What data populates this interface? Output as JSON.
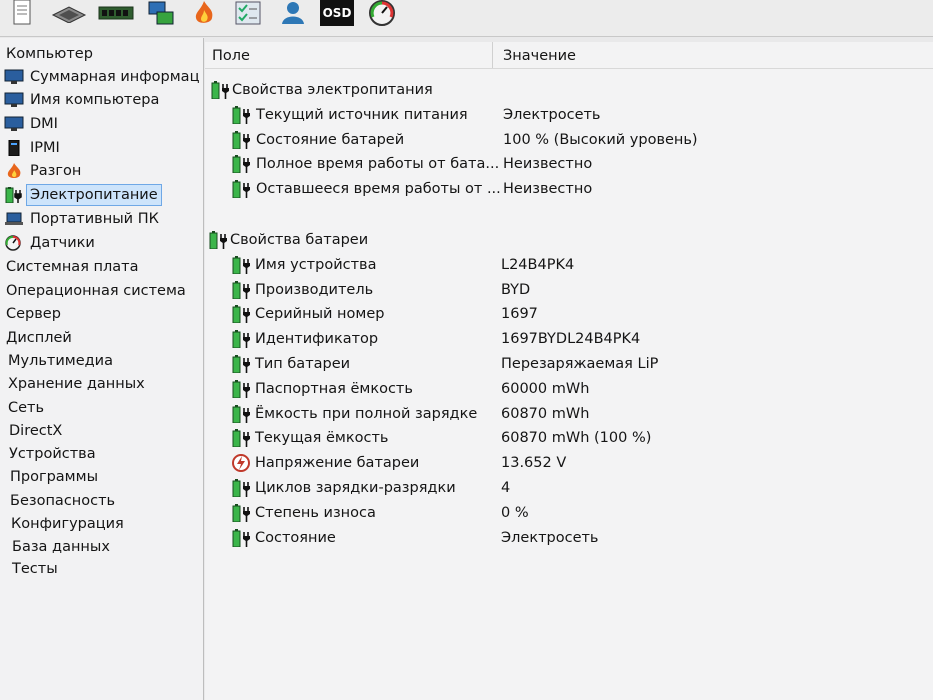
{
  "toolbar": {
    "icons": [
      "document-icon",
      "chip-icon",
      "memory-icon",
      "network-icon",
      "flame-icon",
      "checklist-icon",
      "user-icon",
      "osd-icon",
      "gauge-icon"
    ],
    "osd_label": "OSD"
  },
  "sidebar": {
    "root": "Компьютер",
    "items": [
      {
        "label": "Суммарная информац",
        "icon": "monitor-icon"
      },
      {
        "label": "Имя компьютера",
        "icon": "monitor-icon"
      },
      {
        "label": "DMI",
        "icon": "monitor-icon"
      },
      {
        "label": "IPMI",
        "icon": "server-icon"
      },
      {
        "label": "Разгон",
        "icon": "flame-icon"
      },
      {
        "label": "Электропитание",
        "icon": "battery-icon"
      },
      {
        "label": "Портативный ПК",
        "icon": "laptop-icon"
      },
      {
        "label": "Датчики",
        "icon": "gauge-icon"
      },
      {
        "label": "Системная плата",
        "icon": ""
      },
      {
        "label": "Операционная система",
        "icon": ""
      },
      {
        "label": "Сервер",
        "icon": ""
      },
      {
        "label": "Дисплей",
        "icon": ""
      },
      {
        "label": "Мультимедиа",
        "icon": ""
      },
      {
        "label": "Хранение данных",
        "icon": ""
      },
      {
        "label": "Сеть",
        "icon": ""
      },
      {
        "label": "DirectX",
        "icon": ""
      },
      {
        "label": "Устройства",
        "icon": ""
      },
      {
        "label": "Программы",
        "icon": ""
      },
      {
        "label": "Безопасность",
        "icon": ""
      },
      {
        "label": "Конфигурация",
        "icon": ""
      },
      {
        "label": "База данных",
        "icon": ""
      },
      {
        "label": "Тесты",
        "icon": ""
      }
    ]
  },
  "list": {
    "col_field": "Поле",
    "col_value": "Значение",
    "group1": {
      "title": "Свойства электропитания",
      "rows": [
        {
          "field": "Текущий источник питания",
          "value": "Электросеть"
        },
        {
          "field": "Состояние батарей",
          "value": "100 % (Высокий уровень)"
        },
        {
          "field": "Полное время работы от бата...",
          "value": "Неизвестно"
        },
        {
          "field": "Оставшееся время работы от ...",
          "value": "Неизвестно"
        }
      ]
    },
    "group2": {
      "title": "Свойства батареи",
      "rows": [
        {
          "field": "Имя устройства",
          "value": "L24B4PK4"
        },
        {
          "field": "Производитель",
          "value": "BYD"
        },
        {
          "field": "Серийный номер",
          "value": "1697"
        },
        {
          "field": "Идентификатор",
          "value": "1697BYDL24B4PK4"
        },
        {
          "field": "Тип батареи",
          "value": "Перезаряжаемая LiP"
        },
        {
          "field": "Паспортная ёмкость",
          "value": "60000 mWh"
        },
        {
          "field": "Ёмкость при полной зарядке",
          "value": "60870 mWh"
        },
        {
          "field": "Текущая ёмкость",
          "value": "60870 mWh  (100 %)"
        },
        {
          "field": "Напряжение батареи",
          "value": "13.652 V"
        },
        {
          "field": "Циклов зарядки-разрядки",
          "value": "4"
        },
        {
          "field": "Степень износа",
          "value": "0 %"
        },
        {
          "field": "Состояние",
          "value": "Электросеть"
        }
      ]
    }
  }
}
